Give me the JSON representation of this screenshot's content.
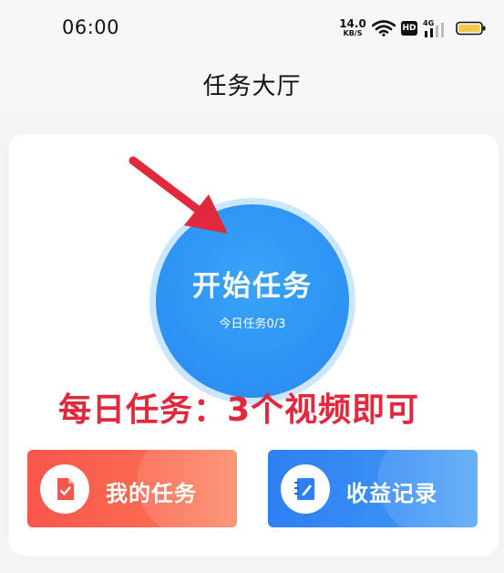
{
  "status_bar": {
    "time": "06:00",
    "net_speed": "14.0",
    "net_speed_unit": "KB/S",
    "hd_label": "HD",
    "network_type": "4G"
  },
  "header": {
    "title": "任务大厅"
  },
  "main": {
    "start_button_label": "开始任务",
    "task_progress": "今日任务0/3",
    "annotation": "每日任务：3个视频即可"
  },
  "actions": {
    "my_tasks_label": "我的任务",
    "earnings_label": "收益记录"
  },
  "colors": {
    "start_button": "#2e95f5",
    "my_tasks_button": "#f8564c",
    "earnings_button": "#2f7ff2",
    "annotation_red": "#e2283d"
  }
}
